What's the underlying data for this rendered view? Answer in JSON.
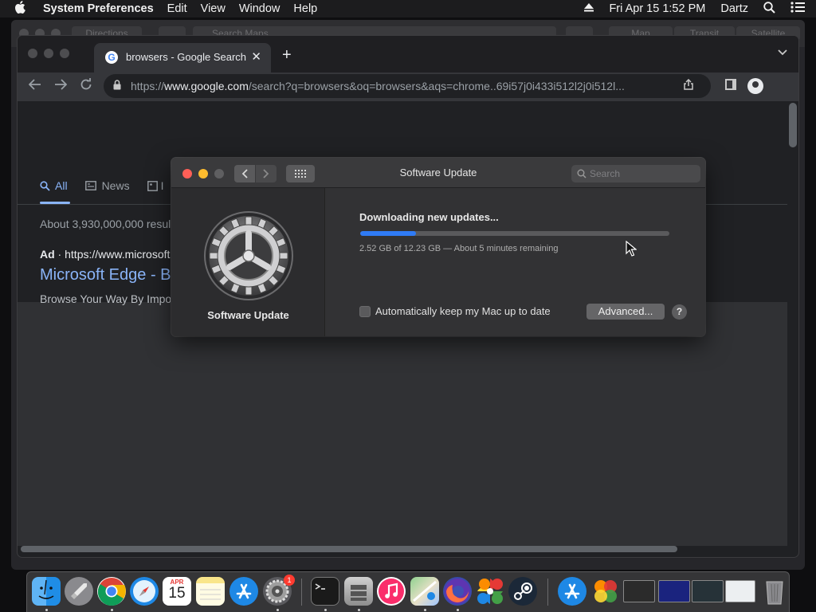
{
  "menubar": {
    "app_name": "System Preferences",
    "menus": [
      "Edit",
      "View",
      "Window",
      "Help"
    ],
    "datetime": "Fri Apr 15  1:52 PM",
    "user": "Dartz"
  },
  "maps": {
    "directions_label": "Directions",
    "search_placeholder": "Search Maps",
    "segments": [
      "Map",
      "Transit",
      "Satellite"
    ]
  },
  "chrome": {
    "tab_title": "browsers - Google Search",
    "url_scheme": "https://",
    "url_host": "www.google.com",
    "url_path": "/search?q=browsers&oq=browsers&aqs=chrome..69i57j0i433i512l2j0i512l..."
  },
  "google": {
    "tabs": [
      "All",
      "News",
      "I"
    ],
    "results_count": "About 3,930,000,000 resul",
    "ad_label": "Ad",
    "ad_url": "https://www.microsoft",
    "ad_title": "Microsoft Edge - B",
    "ad_desc": "Browse Your Way By Impo"
  },
  "software_update": {
    "window_title": "Software Update",
    "search_placeholder": "Search",
    "pane_label": "Software Update",
    "status": "Downloading new updates...",
    "progress_fraction": 0.18,
    "progress_text": "2.52 GB of 12.23 GB — About 5 minutes remaining",
    "auto_update_label": "Automatically keep my Mac up to date",
    "auto_update_checked": false,
    "advanced_label": "Advanced...",
    "help_label": "?"
  },
  "dock": {
    "calendar_month": "APR",
    "calendar_day": "15",
    "sysprefs_badge": "1"
  },
  "colors": {
    "accent_blue": "#2f7bf5",
    "link_blue": "#8ab4f8",
    "close_red": "#fe5f57",
    "minimize_yellow": "#febc2e"
  }
}
